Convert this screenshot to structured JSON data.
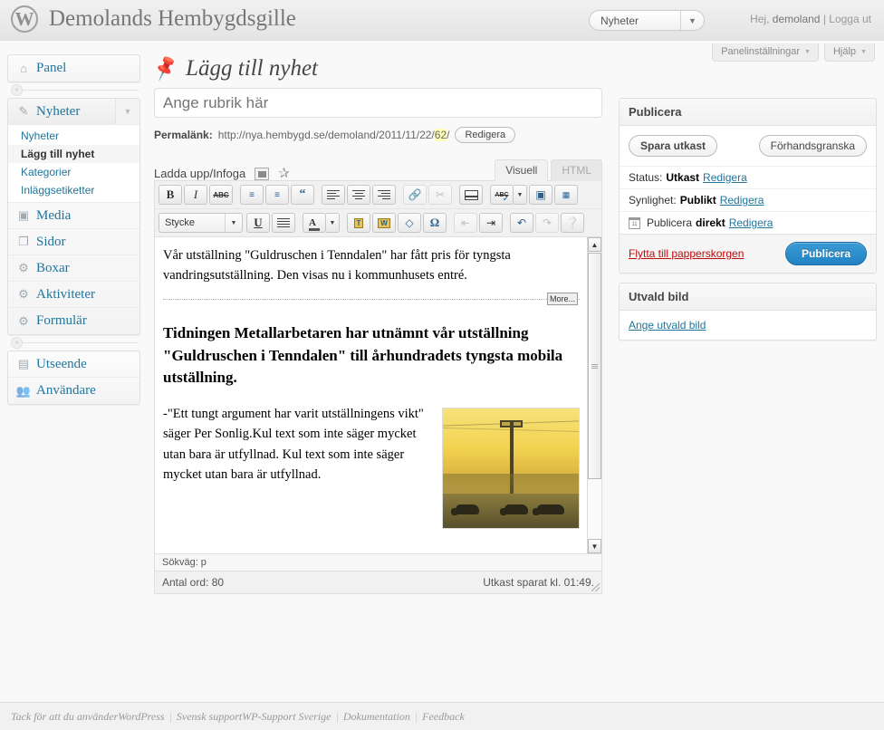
{
  "header": {
    "logo_icon": "wordpress-logo-icon",
    "site_title": "Demolands Hembygdsgille",
    "site_switcher_value": "Nyheter",
    "site_switcher_caret": "▼",
    "greeting_prefix": "Hej, ",
    "user_name": "demoland",
    "greeting_sep": " | ",
    "logout_label": "Logga ut"
  },
  "screen_meta": {
    "screen_options_label": "Panelinställningar",
    "help_label": "Hjälp",
    "caret": "▼"
  },
  "sidebar": {
    "dashboard": {
      "label": "Panel",
      "icon": "home-icon"
    },
    "posts": {
      "label": "Nyheter",
      "icon": "pin-icon",
      "arrow": "▼",
      "submenu": [
        {
          "label": "Nyheter",
          "current": false
        },
        {
          "label": "Lägg till nyhet",
          "current": true
        },
        {
          "label": "Kategorier",
          "current": false
        },
        {
          "label": "Inläggsetiketter",
          "current": false
        }
      ]
    },
    "items": [
      {
        "label": "Media",
        "icon": "media-icon"
      },
      {
        "label": "Sidor",
        "icon": "pages-icon"
      },
      {
        "label": "Boxar",
        "icon": "gear-icon"
      },
      {
        "label": "Aktiviteter",
        "icon": "gear-icon"
      },
      {
        "label": "Formulär",
        "icon": "gear-icon"
      }
    ],
    "bottom_items": [
      {
        "label": "Utseende",
        "icon": "appearance-icon"
      },
      {
        "label": "Användare",
        "icon": "users-icon"
      }
    ],
    "collapse_icon": "collapse-chevron-icon"
  },
  "main": {
    "page_title": "Lägg till nyhet",
    "page_title_icon": "pin-icon",
    "title_placeholder": "Ange rubrik här",
    "title_value": "",
    "permalink": {
      "label": "Permalänk:",
      "url_prefix": "http://nya.hembygd.se/demoland/2011/11/22/",
      "slug": "62",
      "url_suffix": "/",
      "edit_button": "Redigera"
    },
    "media": {
      "label": "Ladda upp/Infoga",
      "image_icon": "insert-media-icon",
      "star_icon": "insert-object-icon"
    },
    "editor_tabs": [
      {
        "label": "Visuell",
        "active": true
      },
      {
        "label": "HTML",
        "active": false
      }
    ],
    "toolbar_row1": [
      {
        "name": "bold-button",
        "glyph": "B",
        "disabled": false
      },
      {
        "name": "italic-button",
        "glyph": "I",
        "disabled": false
      },
      {
        "name": "strikethrough-button",
        "glyph": "ABC",
        "disabled": false
      },
      {
        "name": "unordered-list-button",
        "glyph": "•≡",
        "disabled": false
      },
      {
        "name": "ordered-list-button",
        "glyph": "1≡",
        "disabled": false
      },
      {
        "name": "blockquote-button",
        "glyph": "“",
        "disabled": false
      },
      {
        "name": "align-left-button",
        "glyph": "≡",
        "disabled": false
      },
      {
        "name": "align-center-button",
        "glyph": "≡",
        "disabled": false
      },
      {
        "name": "align-right-button",
        "glyph": "≡",
        "disabled": false
      },
      {
        "name": "insert-link-button",
        "glyph": "🔗",
        "disabled": true
      },
      {
        "name": "unlink-button",
        "glyph": "✂",
        "disabled": true
      },
      {
        "name": "insert-more-button",
        "glyph": "▤",
        "disabled": false
      },
      {
        "name": "spellcheck-button",
        "glyph": "ABC✔",
        "disabled": false
      },
      {
        "name": "fullscreen-button",
        "glyph": "▣",
        "disabled": false
      },
      {
        "name": "kitchen-sink-button",
        "glyph": "▦",
        "disabled": false
      }
    ],
    "toolbar_row2": {
      "style_select_value": "Stycke",
      "style_select_caret": "▼",
      "buttons": [
        {
          "name": "underline-button",
          "glyph": "U",
          "disabled": false
        },
        {
          "name": "justify-button",
          "glyph": "≣",
          "disabled": false
        },
        {
          "name": "text-color-button",
          "glyph": "A",
          "disabled": false
        },
        {
          "name": "paste-as-text-button",
          "glyph": "T",
          "disabled": false
        },
        {
          "name": "paste-from-word-button",
          "glyph": "W",
          "disabled": false
        },
        {
          "name": "remove-formatting-button",
          "glyph": "✎",
          "disabled": false
        },
        {
          "name": "special-character-button",
          "glyph": "Ω",
          "disabled": false
        },
        {
          "name": "outdent-button",
          "glyph": "⇤",
          "disabled": true
        },
        {
          "name": "indent-button",
          "glyph": "⇥",
          "disabled": false
        },
        {
          "name": "undo-button",
          "glyph": "↶",
          "disabled": false
        },
        {
          "name": "redo-button",
          "glyph": "↷",
          "disabled": true
        },
        {
          "name": "help-button",
          "glyph": "?",
          "disabled": false
        }
      ]
    },
    "content": {
      "paragraph_1": "Vår utställning \"Guldruschen i Tenndalen\" har fått pris för tyngsta vandringsutställning. Den visas nu i kommunhusets entré.",
      "more_badge": "More...",
      "heading": "Tidningen Metallarbetaren har utnämnt vår utställning \"Guldruschen i Tenndalen\" till århundradets tyngsta mobila utställning.",
      "paragraph_2": "-\"Ett tungt argument har varit utställningens vikt\" säger Per Sonlig.Kul text som inte säger mycket utan bara är utfyllnad. Kul text som inte säger mycket utan bara är utfyllnad.",
      "image_alt": "sunset-field-with-cattle-photo"
    },
    "path_bar": "Sökväg: p",
    "word_count": "Antal ord: 80",
    "autosave_notice": "Utkast sparat kl. 01:49."
  },
  "publish_box": {
    "title": "Publicera",
    "save_draft_label": "Spara utkast",
    "preview_label": "Förhandsgranska",
    "status_label": "Status:",
    "status_value": "Utkast",
    "status_edit": "Redigera",
    "visibility_label": "Synlighet:",
    "visibility_value": "Publikt",
    "visibility_edit": "Redigera",
    "schedule_icon": "calendar-icon",
    "schedule_label": "Publicera",
    "schedule_value": "direkt",
    "schedule_edit": "Redigera",
    "trash_label": "Flytta till papperskorgen",
    "publish_label": "Publicera",
    "publish_button_color": "#2383c4"
  },
  "featured_image_box": {
    "title": "Utvald bild",
    "set_link": "Ange utvald bild"
  },
  "footer": {
    "thanks_prefix": "Tack för att du använder ",
    "wordpress_label": "WordPress",
    "support_prefix": "Svensk support ",
    "support_label": "WP-Support Sverige",
    "docs_label": "Dokumentation",
    "feedback_label": "Feedback",
    "separator": "|"
  }
}
